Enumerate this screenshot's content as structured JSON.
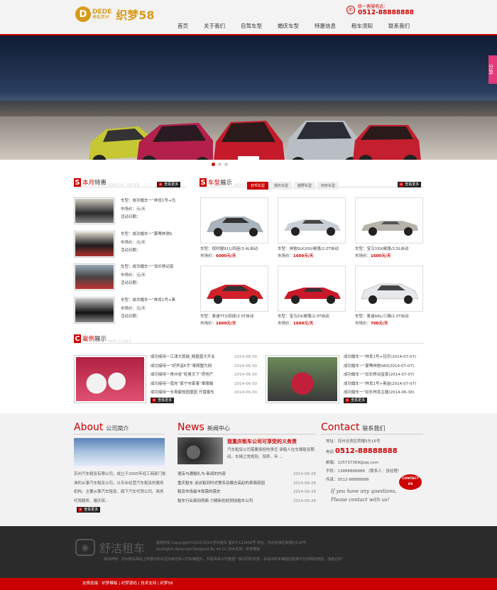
{
  "header": {
    "logo_letter": "D",
    "logo_text_top": "DEDE",
    "logo_text_bottom": "模板素材",
    "logo_big": "织梦58",
    "phone_label": "统一客服电话：",
    "phone_number": "0512-88888888",
    "phone_icon": "phone-icon"
  },
  "nav": [
    "首页",
    "关于我们",
    "自驾车型",
    "婚庆车型",
    "特惠信息",
    "租车须知",
    "联系我们"
  ],
  "share_label": "分享",
  "specials": {
    "title_red": "本月",
    "title_black": "特惠",
    "sub": "SPECIAL OFFER",
    "more": "查看更多",
    "items": [
      {
        "line1": "车型：成功婚车一“林肯1号+玛",
        "line2": "市场价：元/天",
        "line3": "活动日期："
      },
      {
        "line1": "车型：成功婚车一“蒙骞奔驰S",
        "line2": "市场价：元/天",
        "line3": "活动日期："
      },
      {
        "line1": "车型：成功婚车一“加长移动富",
        "line2": "市场价：元/天",
        "line3": "活动日期："
      },
      {
        "line1": "车型：成功婚车一“林肯1号+奥",
        "line2": "市场价：元/天",
        "line3": "活动日期："
      }
    ]
  },
  "models": {
    "title_red": "车型",
    "title_black": "展示",
    "sub": "VEHICLE CASES",
    "tabs": [
      "自驾车型",
      "婚庆车型",
      "越野车型",
      "商务车型"
    ],
    "more": "查看更多",
    "cars": [
      {
        "name": "车型：保时捷911/四座/3.4L自动",
        "price_label": "市场价：",
        "price": "6000元/天"
      },
      {
        "name": "车型：奔驰SLK200/敞篷/2.0T自动",
        "price_label": "市场价：",
        "price": "1600元/天"
      },
      {
        "name": "车型：宝马330/敞篷/2.5L自动",
        "price_label": "市场价：",
        "price": "1600元/天"
      },
      {
        "name": "车型：奥迪TT3/四座/2.0T自动",
        "price_label": "市场价：",
        "price": "1600元/天"
      },
      {
        "name": "车型：宝马Z4/敞篷/2.0T自动",
        "price_label": "市场价：",
        "price": "1600元/天"
      },
      {
        "name": "车型：奥迪A6L/三厢/2.0T自动",
        "price_label": "市场价：",
        "price": "700元/天"
      }
    ]
  },
  "cases": {
    "title_red": "案例",
    "title_black": "展示",
    "sub": "OUR CASES",
    "more": "查看更多",
    "left": [
      {
        "t": "成功接待一江津大观城_精盈盛大开业",
        "d": "2014-06-30"
      },
      {
        "t": "成功接待一“好声音E手”車問盟为网",
        "d": "2014-06-30"
      },
      {
        "t": "成功接待一贵州省“轻奥天下”房地产",
        "d": "2014-06-30"
      },
      {
        "t": "成功接待一南充“家宁市家事”單服娟",
        "d": "2014-06-30"
      },
      {
        "t": "成功接待一长寿碧桂园盛园 开盘婚车",
        "d": "2014-06-30"
      }
    ],
    "right": [
      {
        "t": "成功婚车一“林肯1号+玛莎(2014-07-07)"
      },
      {
        "t": "成功婚车一“蒙骞奔驰S60(2014-07-07)"
      },
      {
        "t": "成功婚车一“加长移动富豪(2014-07-07)"
      },
      {
        "t": "成功婚车一“林肯1号+奥迪(2014-07-07)"
      },
      {
        "t": "成功婚车一“加长林肯主題(2014-06-30)"
      }
    ]
  },
  "about": {
    "title_red": "About",
    "title_black": "公司简介",
    "text": "苏州汽车租赁有限公司，成立于2005年经工商部门批准的从事汽车租赁公司，以专业经营汽车租赁的服务机构。主要从事汽车租赁、旗下汽车代驾公司、商务代驾服务、婚庆保...",
    "more": "查看更多"
  },
  "news": {
    "title_red": "News",
    "title_black": "新闻中心",
    "headline": "我重庆租车公司可享受的义务责",
    "summary": "汽车租赁公司需要承担的责任 承租人在车辆租赁期间，车辆之常规险、保养、年 ...",
    "items": [
      {
        "t": "酒店与通婚礼与-新闻的内容",
        "d": "2014-06-28"
      },
      {
        "t": "重庆租车-谈谈租到时式警杀及载志高赵的表面原因",
        "d": "2014-06-28"
      },
      {
        "t": "租赁市场最丰厚需的需史",
        "d": "2014-06-28"
      },
      {
        "t": "租车行业部初例面 力精新创初例加租车公司",
        "d": "2014-06-28"
      }
    ]
  },
  "contact": {
    "title_red": "Contact",
    "title_black": "联系我们",
    "address": "地址：苏州沧浪区转帽5头16号",
    "tel_label": "电话",
    "tel": "0512-88888888",
    "email": "邮箱：125737369@qq.com",
    "mobile": "手机：13888888888 （联系人：张经理）",
    "fax": "传真：0512-88888888",
    "quote": "If you have any questions, Please contact with us!",
    "badge1": "CONTACT",
    "badge2": "US"
  },
  "footer": {
    "logo_name": "舒洁租车",
    "line1": "版权所有 Copyright©2010-2014.苏州租车 蜀ICP:123456号  地址：苏州沧浪区转帽5头16号",
    "line2": "ALLRights Reserved Designed By mt.CC 技术支持：织梦模板",
    "line3": "特别声明：苏州租车网站上所展示的车型均来自本公司车辆图片，并经由本公司整理一般均同的实表，本站中的车辆提前拒接不任何网站用途，违者必究！",
    "links": "友情连接：织梦模板 | 织梦源码 | 技术支持 | 织梦58"
  }
}
